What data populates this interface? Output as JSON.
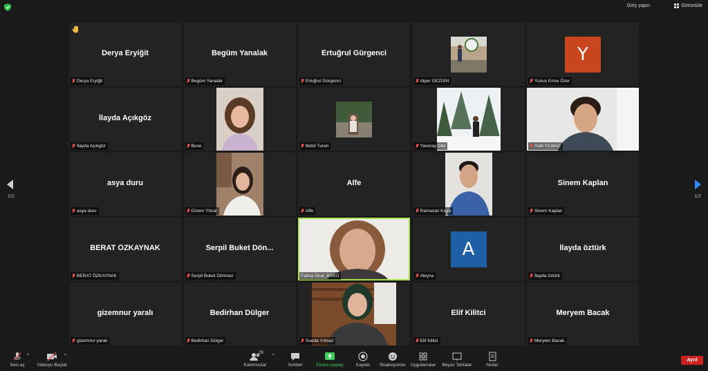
{
  "topbar": {
    "signin_label": "Giriş yapın",
    "view_label": "Görüntüle"
  },
  "pagination": {
    "left": "1/2",
    "right": "1/2"
  },
  "tiles": [
    {
      "center": "Derya Eryiğit",
      "label": "Derya Eryiğit"
    },
    {
      "center": "Begüm Yanalak",
      "label": "Begüm Yanalak"
    },
    {
      "center": "Ertuğrul Gürgenci",
      "label": "Ertuğrul Gürgenci"
    },
    {
      "center": "",
      "label": "Alper GEZGİN"
    },
    {
      "center": "",
      "label": "Yunus Emre Özer",
      "avatar": "Y"
    },
    {
      "center": "İlayda Açıkgöz",
      "label": "İlayda Açıkgöz"
    },
    {
      "center": "",
      "label": "Buse"
    },
    {
      "center": "",
      "label": "Betül Turan"
    },
    {
      "center": "",
      "label": "Yarenay Dibi"
    },
    {
      "center": "",
      "label": "Halil YILMAZ"
    },
    {
      "center": "asya duru",
      "label": "asya duru"
    },
    {
      "center": "",
      "label": "Gizem Yönal"
    },
    {
      "center": "Alfe",
      "label": "Alfe"
    },
    {
      "center": "",
      "label": "Ramazan Kaya"
    },
    {
      "center": "Sinem Kaplan",
      "label": "Sinem Kaplan"
    },
    {
      "center": "BERAT ÖZKAYNAK",
      "label": "BERAT ÖZKAYNAK"
    },
    {
      "center": "Serpil Buket Dön...",
      "label": "Serpil Buket Dönmez"
    },
    {
      "center": "",
      "label": "Fatma Ünal_BARÜ"
    },
    {
      "center": "",
      "label": "Aleyna",
      "avatar": "A"
    },
    {
      "center": "İlayda öztürk",
      "label": "İlayda öztürk"
    },
    {
      "center": "gizemnur yaralı",
      "label": "gizemnur yaralı"
    },
    {
      "center": "Bedirhan Dülger",
      "label": "Bedirhan Dülger"
    },
    {
      "center": "",
      "label": "Sueda Yılmaz"
    },
    {
      "center": "Elif Kilitci",
      "label": "Elif Kilitci"
    },
    {
      "center": "Meryem Bacak",
      "label": "Meryem Bacak"
    }
  ],
  "toolbar": {
    "audio": "Sesi aç",
    "video": "Videoyu Başlat",
    "participants": "Katılımcılar",
    "participant_count": "29",
    "chat": "Sohbet",
    "share": "Ekranı paylaş",
    "record": "Kaydet",
    "reactions": "Reaksiyonlar",
    "apps": "Uygulamalar",
    "whiteboard": "Beyaz Tahtalar",
    "notes": "Notlar",
    "leave": "Ayrıl"
  },
  "colors": {
    "background": "#1a1a1a",
    "tile": "#232323",
    "active_speaker": "#a6e44a",
    "avatar_y": "#c8451e",
    "avatar_a": "#1f5fa6",
    "share_green": "#3ccf5b",
    "leave_red": "#cc2222"
  },
  "icons": [
    "shield-icon",
    "view-grid-icon",
    "raised-hand-icon",
    "muted-mic-icon",
    "mic-muted-icon",
    "video-off-icon",
    "participants-icon",
    "chat-icon",
    "share-screen-icon",
    "record-icon",
    "reactions-icon",
    "apps-icon",
    "whiteboard-icon",
    "notes-icon"
  ]
}
